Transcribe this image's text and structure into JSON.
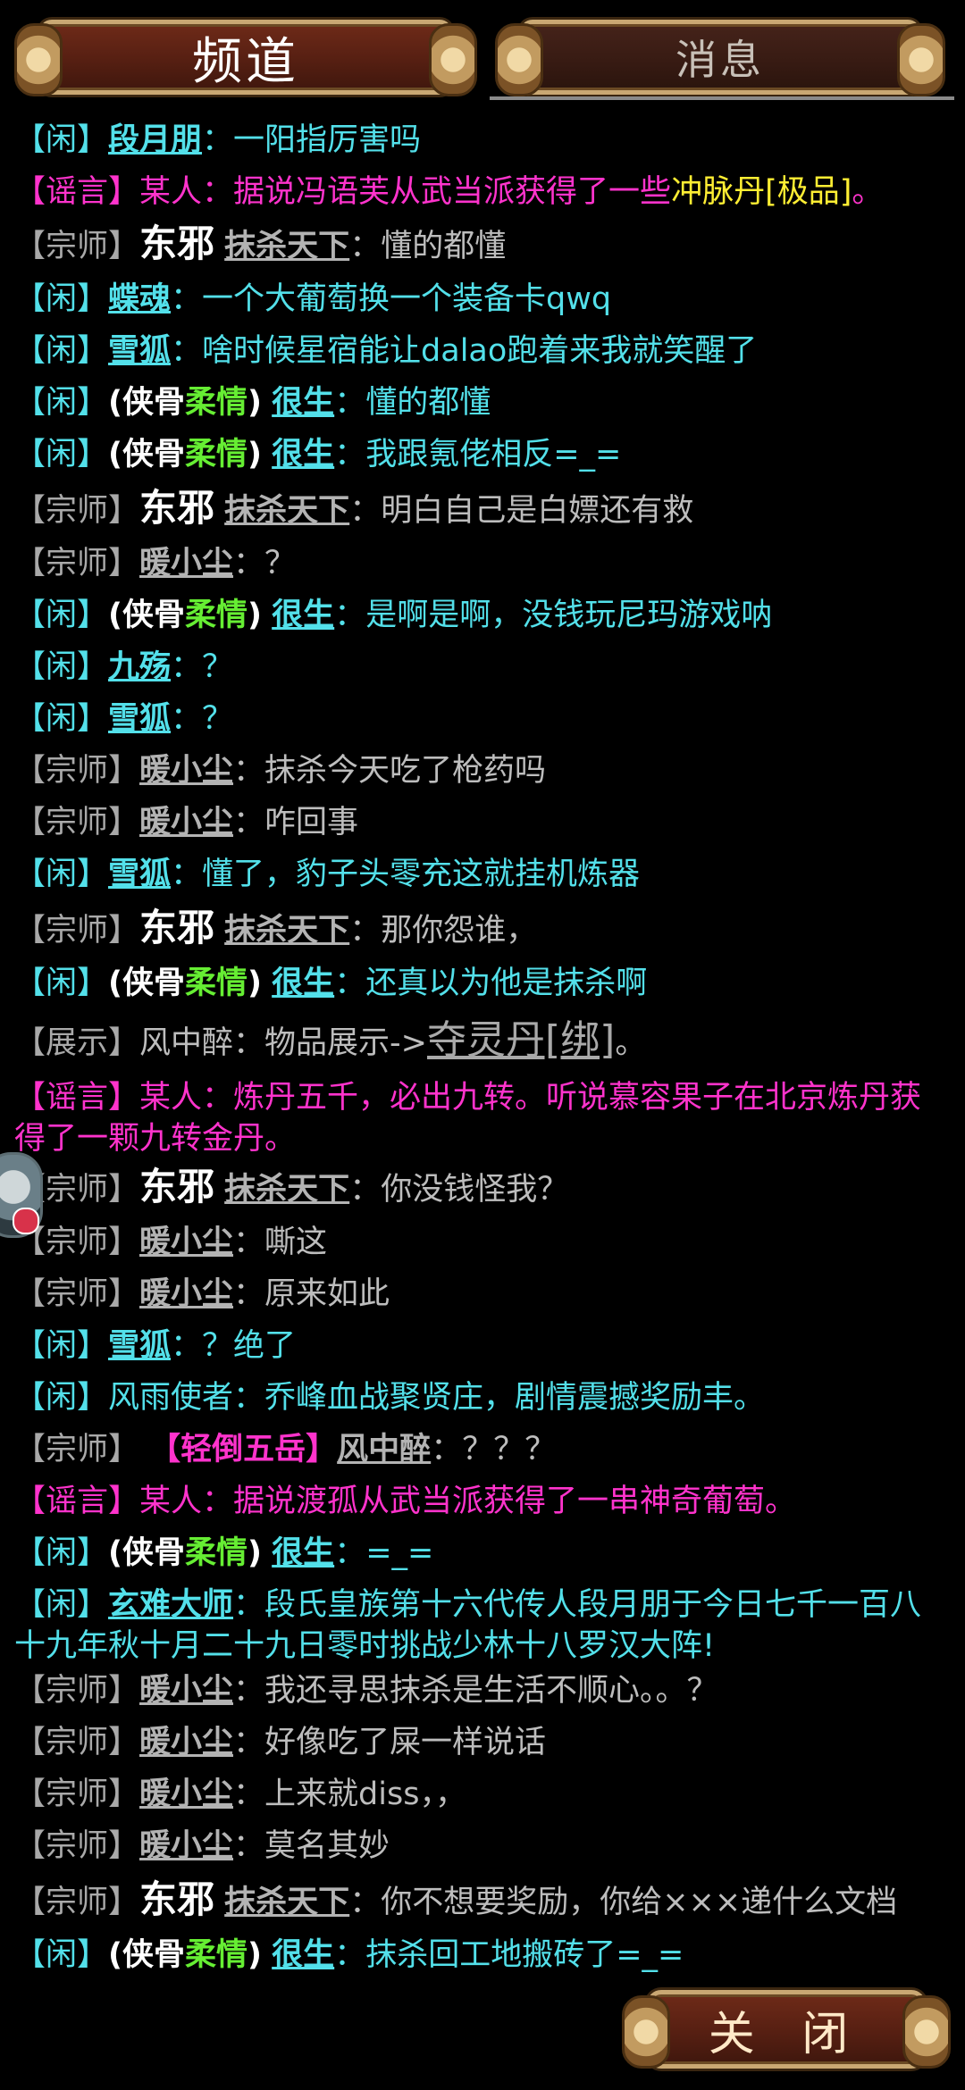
{
  "tabs": {
    "channel": "频道",
    "news": "消息"
  },
  "labels": {
    "idle": "【闲】",
    "master": "【宗师】",
    "rumor": "【谣言】",
    "show": "【展示】",
    "colon": "："
  },
  "names": {
    "duan": "段月朋",
    "diehun": "蝶魂",
    "xuehu": "雪狐",
    "hensheng": "很生",
    "dongxie": "东邪",
    "moshatianxia": "抹杀天下",
    "nuanxiaochen": "暖小尘",
    "jiushang": "九殇",
    "fengzhongzui": "风中醉",
    "xuannan": "玄难大师",
    "someone": "某人",
    "fengyushizhe": "风雨使者"
  },
  "prefix": {
    "open": "(侠骨",
    "soft": "柔情",
    "close": ")"
  },
  "messages": {
    "m1": "一阳指厉害吗",
    "m2a": "据说冯语芙从武当派获得了一些",
    "m2b": "冲脉丹[极品]",
    "m2c": "。",
    "m3": "懂的都懂",
    "m4": "一个大葡萄换一个装备卡qwq",
    "m5": "啥时候星宿能让dalao跑着来我就笑醒了",
    "m6": "懂的都懂",
    "m7": "我跟氪佬相反=_=",
    "m8": "明白自己是白嫖还有救",
    "m9": "？",
    "m10": "是啊是啊，没钱玩尼玛游戏呐",
    "m11": "？",
    "m12": "？",
    "m13": "抹杀今天吃了枪药吗",
    "m14": "咋回事",
    "m15": "懂了，豹子头零充这就挂机炼器",
    "m16": "那你怨谁，",
    "m17": "还真以为他是抹杀啊",
    "m18a": "物品展示->",
    "m18b": "夺灵丹[绑]",
    "m18c": "。",
    "m19": "炼丹五千，必出九转。听说慕容果子在北京炼丹获得了一颗九转金丹。",
    "m20": "你没钱怪我？",
    "m21": "嘶这",
    "m22": "原来如此",
    "m23": "？绝了",
    "m24": "乔峰血战聚贤庄，剧情震撼奖励丰。",
    "m25title": "【轻倒五岳】",
    "m25": "？？？",
    "m26": "据说渡孤从武当派获得了一串神奇葡萄。",
    "m27": "=_=",
    "m28": "段氏皇族第十六代传人段月朋于今日七千一百八十九年秋十月二十九日零时挑战少林十八罗汉大阵!",
    "m29": "我还寻思抹杀是生活不顺心。。？",
    "m30": "好像吃了屎一样说话",
    "m31": "上来就diss，，",
    "m32": "莫名其妙",
    "m33": "你不想要奖励，你给×××递什么文档",
    "m34": "抹杀回工地搬砖了=_="
  },
  "close_button": "关 闭"
}
